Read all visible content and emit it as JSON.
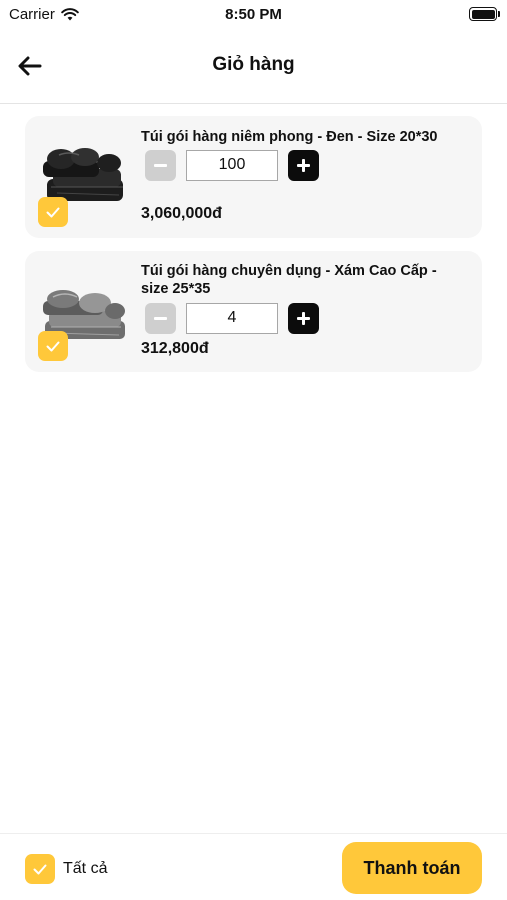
{
  "status_bar": {
    "carrier": "Carrier",
    "time": "8:50 PM",
    "icons": [
      "wifi-icon",
      "battery-icon"
    ]
  },
  "header": {
    "back_icon": "arrow-left-icon",
    "title": "Giỏ hàng"
  },
  "cart": {
    "items": [
      {
        "name": "Túi gói hàng niêm phong - Đen - Size 20*30",
        "quantity": "100",
        "price": "3,060,000đ",
        "checked": true,
        "image": "black-packaging-bags-image"
      },
      {
        "name": "Túi gói hàng chuyên dụng - Xám Cao Cấp - size 25*35",
        "quantity": "4",
        "price": "312,800đ",
        "checked": true,
        "image": "gray-packaging-bags-image"
      }
    ]
  },
  "footer": {
    "select_all_label": "Tất cả",
    "select_all_checked": true,
    "checkout_label": "Thanh toán"
  },
  "colors": {
    "accent": "#ffc83a",
    "card_bg": "#f6f6f6",
    "minus_disabled": "#cfcfcf",
    "plus_bg": "#0c0c0c"
  }
}
